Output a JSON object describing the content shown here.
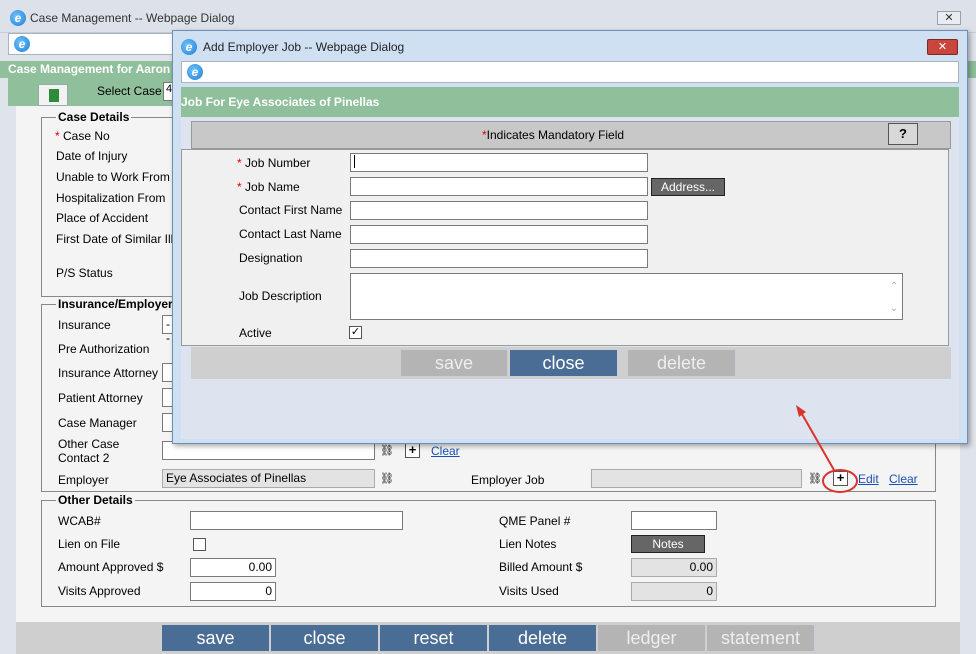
{
  "outer": {
    "title": "Case Management -- Webpage Dialog",
    "close_glyph": "✕",
    "header": "Case Management for Aaron",
    "select_case_label": "Select Case",
    "select_case_value": "4",
    "case_details": {
      "legend": "Case Details",
      "case_no": "Case No",
      "date_of_injury": "Date of Injury",
      "unable_to_work_from": "Unable to Work From",
      "hospitalization_from": "Hospitalization From",
      "place_of_accident": "Place of Accident",
      "first_date_similar": "First Date of Similar Ill",
      "ps_status": "P/S Status"
    },
    "insurance": {
      "legend": "Insurance/Employer",
      "insurance": "Insurance",
      "insurance_value": "--",
      "pre_authorization": "Pre Authorization",
      "insurance_attorney": "Insurance Attorney",
      "patient_attorney": "Patient Attorney",
      "case_manager": "Case Manager",
      "other_case_contact_line1": "Other Case",
      "other_case_contact_line2": "Contact 2",
      "employer": "Employer",
      "employer_value": "Eye Associates of Pinellas",
      "employer_job": "Employer Job",
      "clear": "Clear",
      "edit": "Edit"
    },
    "other": {
      "legend": "Other Details",
      "wcab": "WCAB#",
      "qme_panel": "QME Panel #",
      "lien_on_file": "Lien on File",
      "lien_notes": "Lien Notes",
      "notes_button": "Notes",
      "amount_approved": "Amount Approved $",
      "amount_approved_value": "0.00",
      "billed_amount": "Billed Amount $",
      "billed_amount_value": "0.00",
      "visits_approved": "Visits Approved",
      "visits_approved_value": "0",
      "visits_used": "Visits Used",
      "visits_used_value": "0"
    },
    "buttons": {
      "save": "save",
      "close": "close",
      "reset": "reset",
      "delete": "delete",
      "ledger": "ledger",
      "statement": "statement"
    }
  },
  "inner": {
    "title": "Add Employer Job -- Webpage Dialog",
    "close_glyph": "✕",
    "header": "Job For Eye Associates of Pinellas",
    "mandatory_note": "Indicates Mandatory Field",
    "help": "?",
    "required_mark": "*",
    "fields": {
      "job_number": "Job Number",
      "job_name": "Job Name",
      "contact_first_name": "Contact First Name",
      "contact_last_name": "Contact Last Name",
      "designation": "Designation",
      "job_description": "Job Description",
      "active": "Active"
    },
    "address_button": "Address...",
    "active_checked_glyph": "✓",
    "buttons": {
      "save": "save",
      "close": "close",
      "delete": "delete"
    }
  },
  "colors": {
    "header_green": "#8fbf9b",
    "button_blue": "#4a6d95",
    "button_disabled": "#b4b4b4",
    "annotation_red": "#d9342b"
  },
  "icons": {
    "binoculars": "binoculars-icon",
    "plus": "plus-icon",
    "browser": "ie-icon"
  }
}
